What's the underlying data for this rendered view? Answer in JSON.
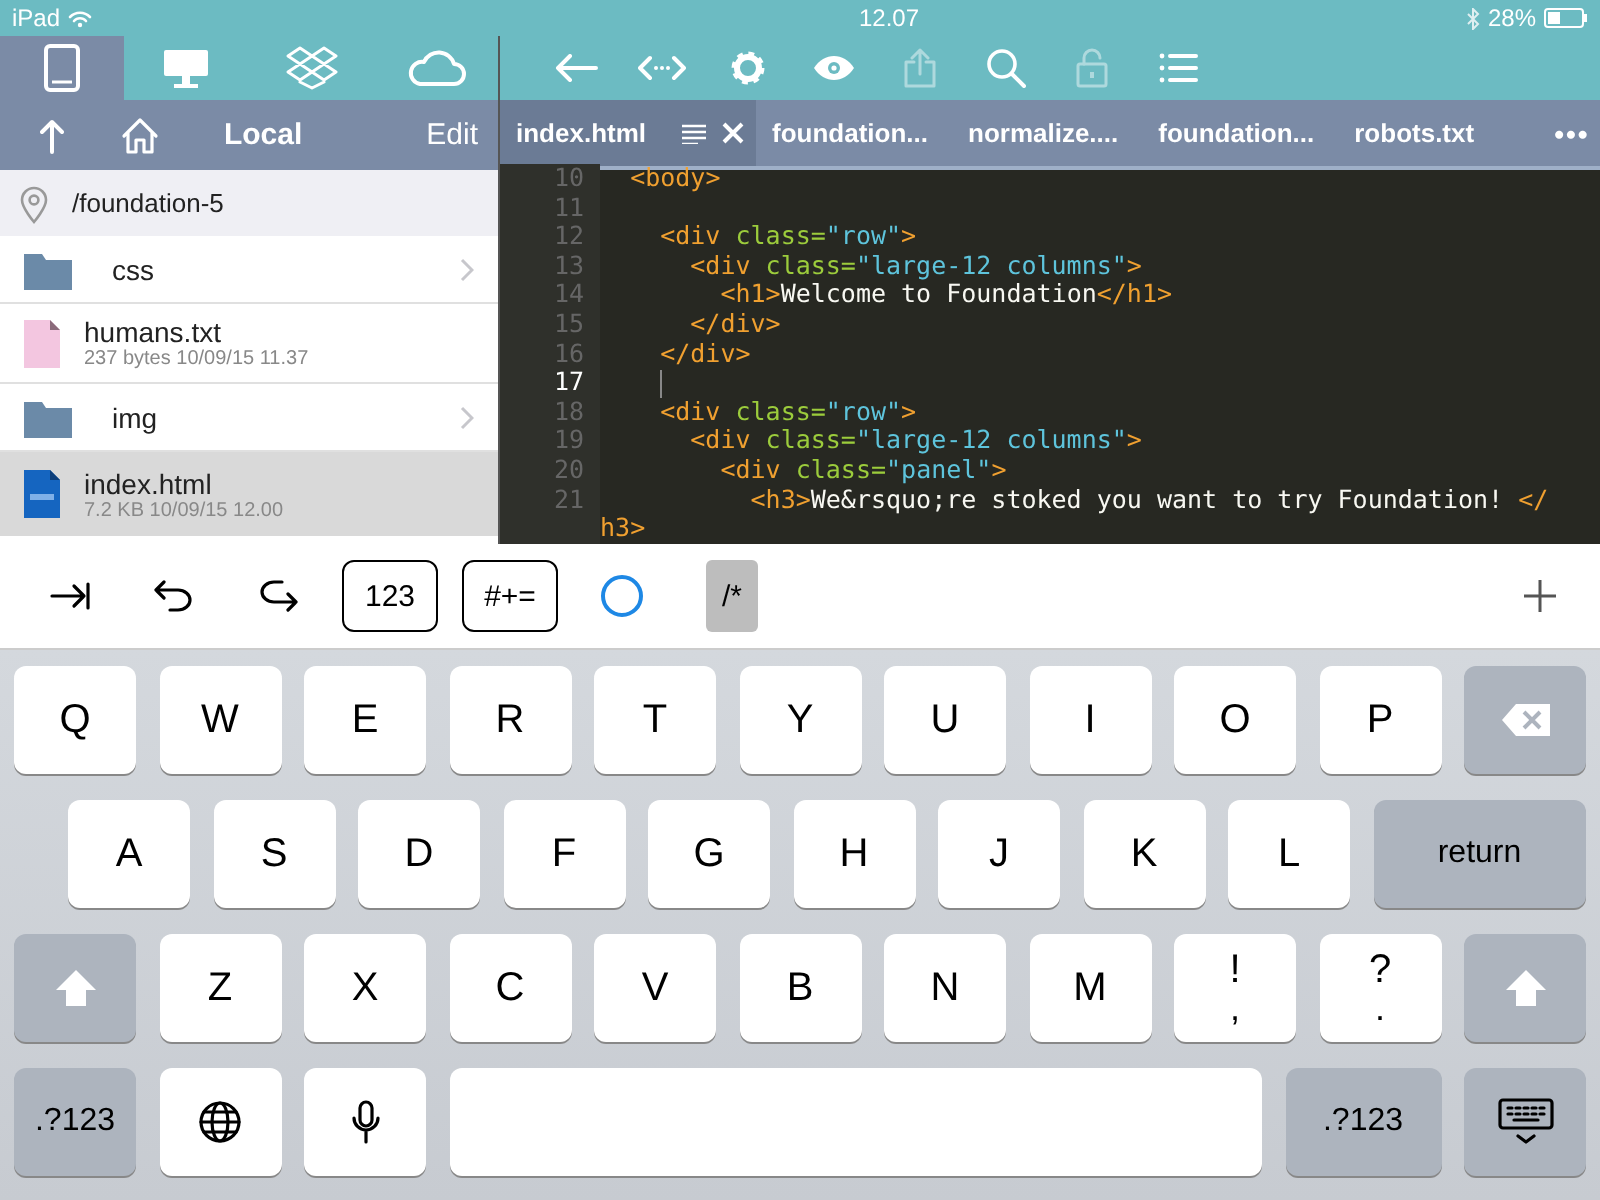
{
  "status_bar": {
    "device": "iPad",
    "time": "12.07",
    "battery": "28%"
  },
  "sidebar": {
    "source_tabs": [
      {
        "kind": "tablet",
        "selected": true
      },
      {
        "kind": "desktop",
        "selected": false
      },
      {
        "kind": "dropbox",
        "selected": false
      },
      {
        "kind": "cloud",
        "selected": false
      }
    ],
    "title": "Local",
    "edit": "Edit",
    "path": "/foundation-5",
    "files": [
      {
        "name": "css",
        "kind": "folder",
        "selected": false
      },
      {
        "name": "humans.txt",
        "meta": "237 bytes 10/09/15 11.37",
        "kind": "text",
        "selected": false
      },
      {
        "name": "img",
        "kind": "folder",
        "selected": false
      },
      {
        "name": "index.html",
        "meta": "7.2 KB 10/09/15 12.00",
        "kind": "html",
        "selected": true
      }
    ]
  },
  "toolbar": [
    {
      "kind": "back",
      "disabled": false
    },
    {
      "kind": "code",
      "disabled": false
    },
    {
      "kind": "gear",
      "disabled": false
    },
    {
      "kind": "eye",
      "disabled": false
    },
    {
      "kind": "share",
      "disabled": true
    },
    {
      "kind": "search",
      "disabled": false
    },
    {
      "kind": "lock",
      "disabled": true
    },
    {
      "kind": "list",
      "disabled": false
    }
  ],
  "tabs": [
    {
      "label": "index.html",
      "selected": true
    },
    {
      "label": "foundation...",
      "selected": false
    },
    {
      "label": "normalize....",
      "selected": false
    },
    {
      "label": "foundation...",
      "selected": false
    },
    {
      "label": "robots.txt",
      "selected": false
    }
  ],
  "tabs_more": "•••",
  "code": [
    {
      "number": "10",
      "current": false,
      "text": "  <body>"
    },
    {
      "number": "11",
      "current": false
    },
    {
      "number": "12",
      "current": false,
      "text": "    <div class=\"row\">"
    },
    {
      "number": "13",
      "current": false,
      "text": "      <div class=\"large-12 columns\">"
    },
    {
      "number": "14",
      "current": false,
      "text": "        <h1>Welcome to Foundation</h1>"
    },
    {
      "number": "15",
      "current": false,
      "text": "      </div>"
    },
    {
      "number": "16",
      "current": false,
      "text": "    </div>"
    },
    {
      "number": "17",
      "current": true
    },
    {
      "number": "18",
      "current": false,
      "text": "    <div class=\"row\">"
    },
    {
      "number": "19",
      "current": false,
      "text": "      <div class=\"large-12 columns\">"
    },
    {
      "number": "20",
      "current": false,
      "text": "        <div class=\"panel\">"
    },
    {
      "number": "21",
      "current": false,
      "text": "          <h3>We&rsquo;re stoked you want to try Foundation! </h3>"
    }
  ],
  "accessory_bar": [
    {
      "kind": "tab"
    },
    {
      "kind": "undo"
    },
    {
      "kind": "redo"
    },
    {
      "kind": "boxed",
      "label": "123"
    },
    {
      "kind": "boxed",
      "label": "#+="
    },
    {
      "kind": "circle"
    },
    {
      "kind": "shaded",
      "label": "/*"
    },
    {
      "kind": "add"
    }
  ],
  "keyboard": [
    [
      {
        "kind": "char",
        "label": "Q"
      },
      {
        "kind": "char",
        "label": "W"
      },
      {
        "kind": "char",
        "label": "E"
      },
      {
        "kind": "char",
        "label": "R"
      },
      {
        "kind": "char",
        "label": "T"
      },
      {
        "kind": "char",
        "label": "Y"
      },
      {
        "kind": "char",
        "label": "U"
      },
      {
        "kind": "char",
        "label": "I"
      },
      {
        "kind": "char",
        "label": "O"
      },
      {
        "kind": "char",
        "label": "P"
      },
      {
        "kind": "delete"
      }
    ],
    [
      {
        "kind": "char",
        "label": "A"
      },
      {
        "kind": "char",
        "label": "S"
      },
      {
        "kind": "char",
        "label": "D"
      },
      {
        "kind": "char",
        "label": "F"
      },
      {
        "kind": "char",
        "label": "G"
      },
      {
        "kind": "char",
        "label": "H"
      },
      {
        "kind": "char",
        "label": "J"
      },
      {
        "kind": "char",
        "label": "K"
      },
      {
        "kind": "char",
        "label": "L"
      },
      {
        "kind": "function",
        "label": "return"
      }
    ],
    [
      {
        "kind": "shift"
      },
      {
        "kind": "char",
        "label": "Z"
      },
      {
        "kind": "char",
        "label": "X"
      },
      {
        "kind": "char",
        "label": "C"
      },
      {
        "kind": "char",
        "label": "V"
      },
      {
        "kind": "char",
        "label": "B"
      },
      {
        "kind": "char",
        "label": "N"
      },
      {
        "kind": "char",
        "label": "M"
      },
      {
        "kind": "char",
        "label": "!",
        "sub": ","
      },
      {
        "kind": "char",
        "label": "?",
        "sub": "."
      },
      {
        "kind": "shift"
      }
    ],
    [
      {
        "kind": "function",
        "label": ".?123"
      },
      {
        "kind": "globe"
      },
      {
        "kind": "mic"
      },
      {
        "kind": "space"
      },
      {
        "kind": "function",
        "label": ".?123"
      },
      {
        "kind": "hide"
      }
    ]
  ]
}
